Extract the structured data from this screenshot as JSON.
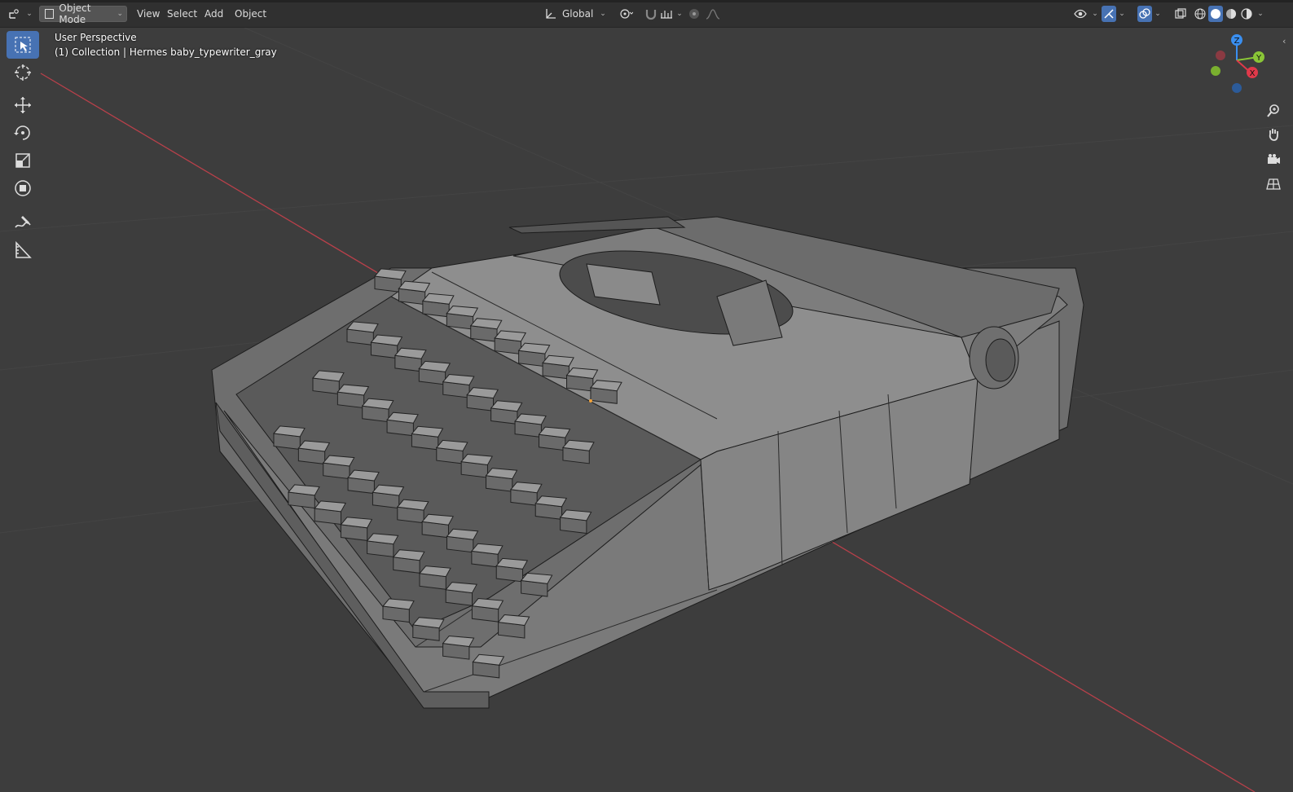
{
  "header": {
    "editor_type_icon": "orbit-icon",
    "mode_label": "Object Mode",
    "menus": [
      "View",
      "Select",
      "Add",
      "Object"
    ],
    "transform_orientation": "Global"
  },
  "overlay": {
    "view_name": "User Perspective",
    "object_info": "(1) Collection | Hermes baby_typewriter_gray"
  },
  "gizmo": {
    "axis_z": "Z",
    "axis_y": "Y",
    "axis_x": "X"
  },
  "colors": {
    "viewport_bg": "#3d3d3d",
    "header_bg": "#303030",
    "active_tool": "#4772b3",
    "x_axis": "#e0394a",
    "y_axis": "#8ac637",
    "z_axis": "#3a8ff0",
    "mesh_face": "#868686",
    "mesh_wire": "#1c1c1c"
  },
  "tools": [
    "select-box-icon",
    "cursor-icon",
    "move-icon",
    "rotate-icon",
    "scale-icon",
    "transform-icon",
    "annotate-icon",
    "measure-icon"
  ],
  "navigation": [
    "zoom-icon",
    "pan-hand-icon",
    "camera-icon",
    "grid-view-icon"
  ]
}
